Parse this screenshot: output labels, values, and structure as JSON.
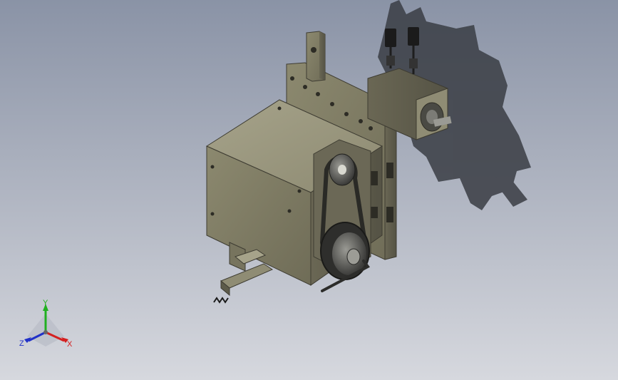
{
  "triad": {
    "x_label": "X",
    "y_label": "Y",
    "z_label": "Z",
    "x_color": "#d42020",
    "y_color": "#20b020",
    "z_color": "#2030c8"
  },
  "colors": {
    "background_top": "#8a93a6",
    "background_bottom": "#d6d8de",
    "model_face_light": "#8f8c74",
    "model_face_mid": "#77745e",
    "model_face_dark": "#5d5b4a",
    "shadow": "#3a3d44"
  }
}
